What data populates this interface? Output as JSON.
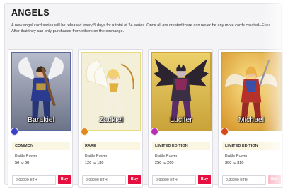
{
  "section": {
    "title": "ANGELS",
    "description_line1": "A new angel card series will be released every 5 days for a total of 24 series. Once all are created there can never be any more cards created--Ever.",
    "description_line2": "After that they can only purchased from others on the exchange."
  },
  "cards": [
    {
      "name": "Barakiel",
      "rarity": "COMMON",
      "battle_power_label": "Battle Power",
      "battle_power": "50 to 60",
      "price": "0.00000 ETH",
      "buy_label": "Buy",
      "colors": {
        "frame": "#5a6a9e",
        "bg": "#8d93a6",
        "gem": "#3b3fc4",
        "rarity_bg": "#fbf6e2"
      }
    },
    {
      "name": "Zadkiel",
      "rarity": "RARE",
      "battle_power_label": "Battle Power",
      "battle_power": "120 to 130",
      "price": "0.03000 ETH",
      "buy_label": "Buy",
      "colors": {
        "frame": "#e8dc7a",
        "bg": "#f3efd9",
        "gem": "#e08a1c",
        "rarity_bg": "#fbf6e2"
      }
    },
    {
      "name": "Lucifer",
      "rarity": "LIMITED EDITION",
      "battle_power_label": "Battle Power",
      "battle_power": "250 to 260",
      "price": "0.66600 ETH",
      "buy_label": "Buy",
      "colors": {
        "frame": "#c9a23a",
        "bg": "#d9b646",
        "gem": "#b42fb4",
        "rarity_bg": "#fbf6e2"
      }
    },
    {
      "name": "Michael",
      "rarity": "LIMITED EDITION",
      "battle_power_label": "Battle Power",
      "battle_power": "300 to 310",
      "price": "0.80000 ETH",
      "buy_label": "Buy",
      "colors": {
        "frame": "#c9a23a",
        "bg": "#e9c055",
        "gem": "#d4471a",
        "rarity_bg": "#fbf6e2"
      }
    }
  ]
}
